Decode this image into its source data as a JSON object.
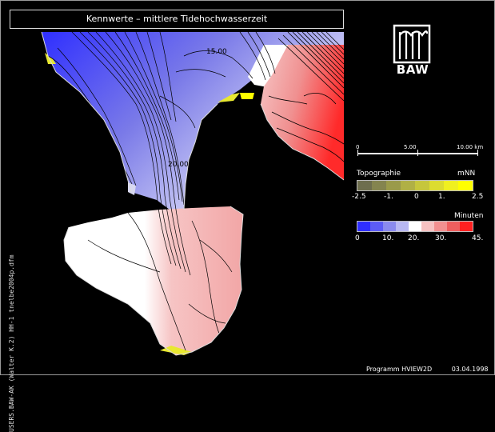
{
  "title": "Kennwerte – mittlere Tidehochwasserzeit",
  "side_text": "USERS.BAW-AK (Walter K.2)  HH-1  tnelbe2004p.dfm",
  "logo": {
    "text": "BAW",
    "icon": "baw-logo-icon"
  },
  "scale_bar": {
    "labels": [
      "0",
      "5.00",
      "10.00 km"
    ]
  },
  "map_labels": {
    "contour_15": "15.00",
    "contour_20": "20.00"
  },
  "topo_legend": {
    "title": "Topographie",
    "unit": "mNN",
    "ticks": [
      "-2.5",
      "-1.",
      "0",
      "1.",
      "2.5"
    ],
    "colors": [
      "#6e6e4e",
      "#84844f",
      "#9a9a4a",
      "#b0b045",
      "#c6c63c",
      "#dcdc30",
      "#f0f020",
      "#ffff00"
    ]
  },
  "time_legend": {
    "title": "Minuten",
    "ticks": [
      "0",
      "10.",
      "20.",
      "30.",
      "45."
    ],
    "colors": [
      "#2f2fff",
      "#5c5cf6",
      "#8a8aee",
      "#b8b8f2",
      "#ffffff",
      "#f6c2c2",
      "#f29090",
      "#ee5e5e",
      "#ff2020"
    ]
  },
  "footer": {
    "program": "Programm HVIEW2D",
    "date": "03.04.1998"
  }
}
